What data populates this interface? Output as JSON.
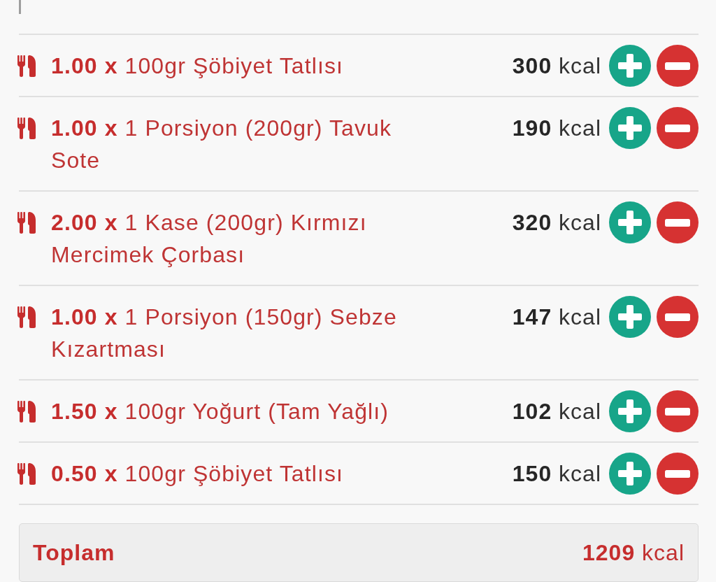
{
  "items": [
    {
      "text": "**1.00 x** 100gr Şöbiyet Tatlısı",
      "calories": "**300** kcal"
    },
    {
      "text": "**1.00 x** 1 Porsiyon (200gr) Tavuk Sote",
      "calories": "**190** kcal"
    },
    {
      "text": "**2.00 x** 1 Kase (200gr) Kırmızı Mercimek Çorbası",
      "calories": "**320** kcal"
    },
    {
      "text": "**1.00 x** 1 Porsiyon (150gr) Sebze Kızartması",
      "calories": "**147** kcal"
    },
    {
      "text": "**1.50 x** 100gr Yoğurt (Tam Yağlı)",
      "calories": "**102** kcal"
    },
    {
      "text": "**0.50 x** 100gr Şöbiyet Tatlısı",
      "calories": "**150** kcal"
    }
  ],
  "total": {
    "label": "Toplam",
    "calories": "**1209** kcal"
  }
}
